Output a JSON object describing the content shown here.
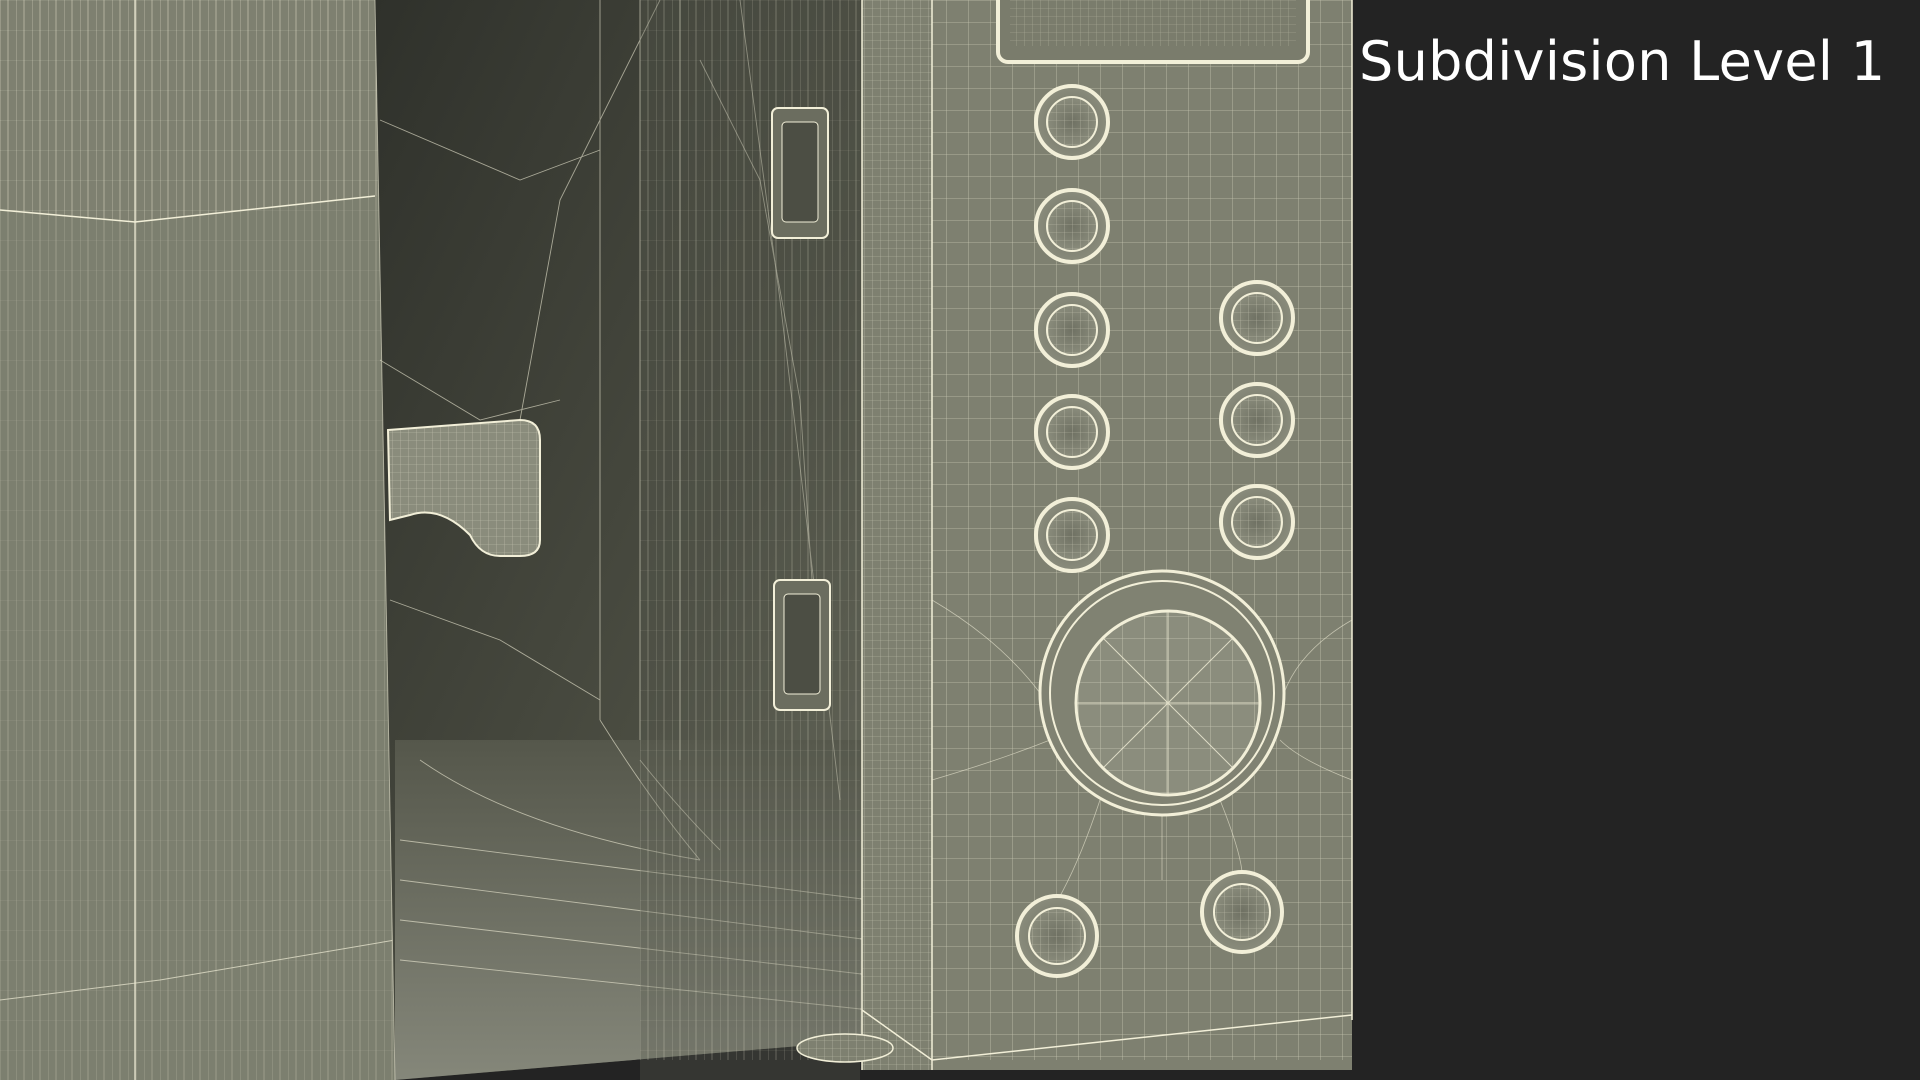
{
  "overlay": {
    "label": "Subdivision Level 1"
  },
  "colors": {
    "background": "#232323",
    "surface": "#7b7d6d",
    "surface_dark": "#33352f",
    "wire": "#f2efd8"
  },
  "scene": {
    "subject": "microwave-oven-wireframe",
    "control_buttons_left_column": 5,
    "control_buttons_right_column": 3,
    "control_buttons_bottom": 2,
    "dial": 1
  }
}
